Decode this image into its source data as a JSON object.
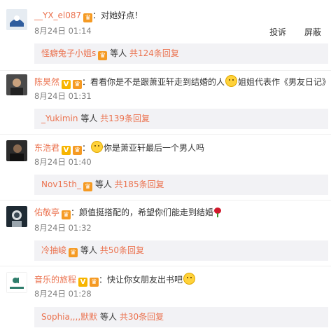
{
  "comments": [
    {
      "username": "__YX_el087",
      "text": "：对她好点！",
      "date": "8月24日 01:14",
      "actions": {
        "report": "投诉",
        "block": "屏蔽"
      },
      "reply": {
        "user": "怪癖兔子小姐s",
        "middle": "等人",
        "count": "共124条回复"
      }
    },
    {
      "username": "陈昊然",
      "text_before_emoji": "：看看你是不是跟萧亚轩走到结婚的人",
      "text_after_emoji": "姐姐代表作《男友日记》",
      "date": "8月24日 01:31",
      "reply": {
        "user": "_Yukimin",
        "middle": "等人",
        "count": "共139条回复"
      }
    },
    {
      "username": "东浩君",
      "text_before_emoji": "：",
      "text_after_emoji": "你是萧亚轩最后一个男人吗",
      "date": "8月24日 01:40",
      "reply": {
        "user": "Nov15th_",
        "middle": "等人",
        "count": "共185条回复"
      }
    },
    {
      "username": "佑敬亭",
      "text": "：颜值挺搭配的，希望你们能走到结婚",
      "date": "8月24日 01:32",
      "reply": {
        "user": "冷抽峻",
        "middle": "等人",
        "count": "共50条回复"
      }
    },
    {
      "username": "音乐的旅程",
      "text": "：快让你女朋友出书吧",
      "date": "8月24日 01:28",
      "reply": {
        "user": "Sophia,,,,默默",
        "middle": "等人",
        "count": "共30条回复"
      }
    }
  ]
}
